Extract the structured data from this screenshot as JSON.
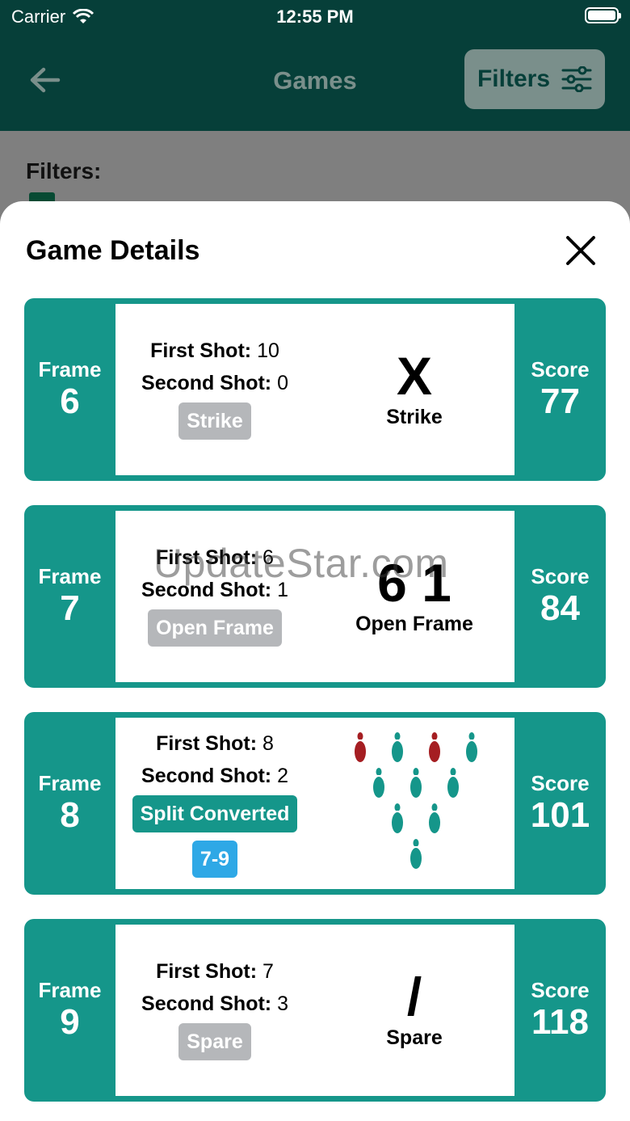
{
  "status_bar": {
    "carrier": "Carrier",
    "time": "12:55 PM"
  },
  "nav": {
    "title": "Games",
    "filters_label": "Filters"
  },
  "background": {
    "filters_heading": "Filters:"
  },
  "sheet": {
    "title": "Game Details",
    "frames": [
      {
        "frame_label": "Frame",
        "frame": "6",
        "first_label": "First Shot:",
        "first": "10",
        "second_label": "Second Shot:",
        "second": "0",
        "tag": "Strike",
        "symbol": "X",
        "result": "Strike",
        "score_label": "Score",
        "score": "77"
      },
      {
        "frame_label": "Frame",
        "frame": "7",
        "first_label": "First Shot:",
        "first": "6",
        "second_label": "Second Shot:",
        "second": "1",
        "tag": "Open Frame",
        "symbol": "6 1",
        "result": "Open Frame",
        "score_label": "Score",
        "score": "84"
      },
      {
        "frame_label": "Frame",
        "frame": "8",
        "first_label": "First Shot:",
        "first": "8",
        "second_label": "Second Shot:",
        "second": "2",
        "tag": "Split Converted",
        "split": "7-9",
        "score_label": "Score",
        "score": "101",
        "pins_down_red": [
          7,
          9
        ],
        "pin_colors": {
          "standing": "#15968a",
          "split": "#a51e22"
        }
      },
      {
        "frame_label": "Frame",
        "frame": "9",
        "first_label": "First Shot:",
        "first": "7",
        "second_label": "Second Shot:",
        "second": "3",
        "tag": "Spare",
        "symbol": "/",
        "result": "Spare",
        "score_label": "Score",
        "score": "118"
      }
    ]
  },
  "watermark": "UpdateStar.com"
}
